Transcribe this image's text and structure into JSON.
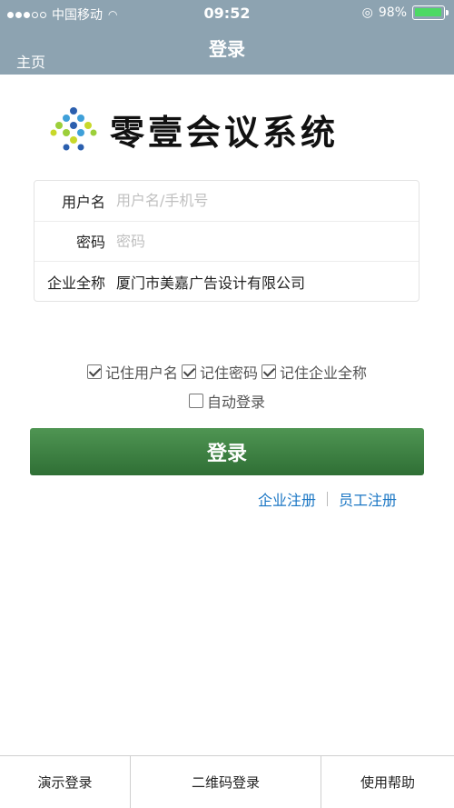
{
  "status_bar": {
    "carrier": "中国移动",
    "time": "09:52",
    "battery_percent": "98%",
    "battery_level": 0.98
  },
  "nav": {
    "title": "登录",
    "back_label": "主页"
  },
  "logo": {
    "text": "零壹会议系统"
  },
  "form": {
    "username": {
      "label": "用户名",
      "placeholder": "用户名/手机号",
      "value": ""
    },
    "password": {
      "label": "密码",
      "placeholder": "密码",
      "value": ""
    },
    "company": {
      "label": "企业全称",
      "value": "厦门市美嘉广告设计有限公司"
    }
  },
  "options": {
    "remember_username": {
      "label": "记住用户名",
      "checked": true
    },
    "remember_password": {
      "label": "记住密码",
      "checked": true
    },
    "remember_company": {
      "label": "记住企业全称",
      "checked": true
    },
    "auto_login": {
      "label": "自动登录",
      "checked": false
    }
  },
  "login_button": {
    "label": "登录"
  },
  "links": {
    "company_register": "企业注册",
    "employee_register": "员工注册"
  },
  "bottom_bar": {
    "demo_login": "演示登录",
    "qr_login": "二维码登录",
    "help": "使用帮助"
  },
  "colors": {
    "nav_bg": "#8da3b1",
    "login_button": "#3d8043",
    "link": "#1a76c4"
  }
}
